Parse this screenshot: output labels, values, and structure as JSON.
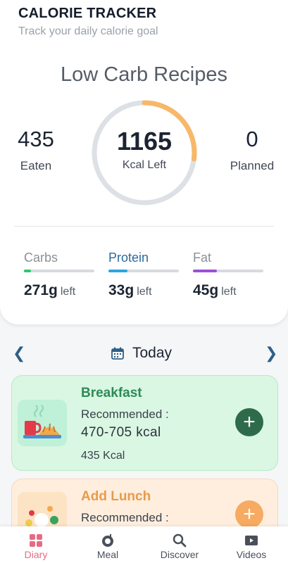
{
  "header": {
    "title": "CALORIE TRACKER",
    "subtitle": "Track your daily calorie goal"
  },
  "plan_name": "Low Carb Recipes",
  "summary": {
    "eaten": {
      "value": "435",
      "label": "Eaten"
    },
    "remaining": {
      "value": "1165",
      "label": "Kcal Left"
    },
    "planned": {
      "value": "0",
      "label": "Planned"
    },
    "ring_progress_fraction": 0.27
  },
  "macros": [
    {
      "name": "Carbs",
      "amount": "271g",
      "suffix": "left",
      "color": "#2fc76b",
      "progress": 0.1
    },
    {
      "name": "Protein",
      "amount": "33g",
      "suffix": "left",
      "color": "#2aa6e0",
      "progress": 0.27
    },
    {
      "name": "Fat",
      "amount": "45g",
      "suffix": "left",
      "color": "#9b4fd6",
      "progress": 0.34
    }
  ],
  "date_nav": {
    "label": "Today",
    "prev_icon": "chevron-left-icon",
    "next_icon": "chevron-right-icon",
    "calendar_icon": "calendar-icon"
  },
  "meals": [
    {
      "name": "Breakfast",
      "recommended_label": "Recommended :",
      "range": "470-705 kcal",
      "logged": "435 Kcal",
      "name_color": "#2e8a57"
    },
    {
      "name": "Add Lunch",
      "recommended_label": "Recommended :",
      "name_color": "#e79b4c"
    }
  ],
  "nav": {
    "items": [
      {
        "label": "Diary",
        "icon": "diary-icon",
        "active": true
      },
      {
        "label": "Meal",
        "icon": "meal-icon",
        "active": false
      },
      {
        "label": "Discover",
        "icon": "search-icon",
        "active": false
      },
      {
        "label": "Videos",
        "icon": "video-icon",
        "active": false
      }
    ]
  },
  "colors": {
    "accent_active": "#e66a84",
    "ring_track": "#dde1e6",
    "ring_progress": "#f7b86a",
    "add_breakfast": "#2e6b4b",
    "add_lunch": "#f6aa62"
  }
}
